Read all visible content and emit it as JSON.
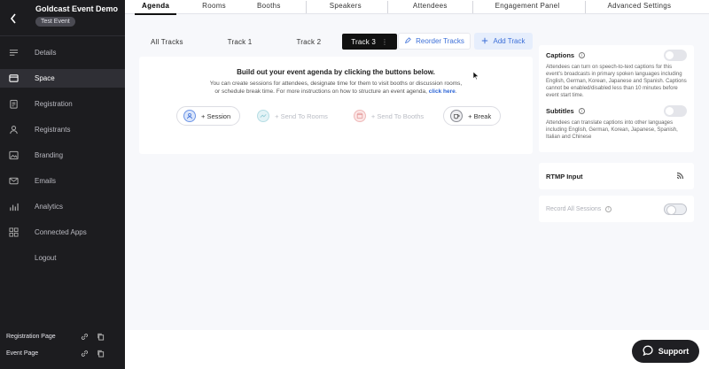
{
  "sidebar": {
    "event_title": "Goldcast Event Demo",
    "badge": "Test Event",
    "items": [
      {
        "label": "Details",
        "icon": "list-icon"
      },
      {
        "label": "Space",
        "icon": "window-icon",
        "active": true
      },
      {
        "label": "Registration",
        "icon": "clipboard-icon"
      },
      {
        "label": "Registrants",
        "icon": "person-icon"
      },
      {
        "label": "Branding",
        "icon": "image-icon"
      },
      {
        "label": "Emails",
        "icon": "mail-icon"
      },
      {
        "label": "Analytics",
        "icon": "bar-chart-icon"
      },
      {
        "label": "Connected Apps",
        "icon": "apps-icon"
      },
      {
        "label": "Logout",
        "icon": ""
      }
    ],
    "bottom_links": [
      {
        "label": "Registration Page"
      },
      {
        "label": "Event Page"
      }
    ]
  },
  "tabs": [
    {
      "label": "Agenda",
      "active": true
    },
    {
      "label": "Rooms"
    },
    {
      "label": "Booths"
    },
    {
      "label": "Speakers"
    },
    {
      "label": "Attendees"
    },
    {
      "label": "Engagement Panel"
    },
    {
      "label": "Advanced Settings"
    }
  ],
  "tracks": [
    {
      "label": "All Tracks"
    },
    {
      "label": "Track 1"
    },
    {
      "label": "Track 2"
    },
    {
      "label": "Track 3",
      "active": true,
      "menu": "⋮"
    }
  ],
  "buttons": {
    "reorder": "Reorder Tracks",
    "add_track": "Add Track"
  },
  "agenda": {
    "title": "Build out your event agenda by clicking the buttons below.",
    "desc_line1": "You can create sessions for attendees, designate time for them to visit booths or discussion rooms,",
    "desc_line2": "or schedule break time. For more instructions on how to structure an event agenda,",
    "desc_link": "click here",
    "desc_end": ".",
    "actions": [
      {
        "label": "+ Session",
        "enabled": true
      },
      {
        "label": "+ Send To Rooms",
        "enabled": false
      },
      {
        "label": "+ Send To Booths",
        "enabled": false
      },
      {
        "label": "+ Break",
        "enabled": true
      }
    ]
  },
  "captions": {
    "label": "Captions",
    "desc": "Attendees can turn on speech-to-text captions for this event's broadcasts in primary spoken languages including English, German, Korean, Japanese and Spanish. Captions cannot be enabled/disabled less than 10 minutes before event start time."
  },
  "subtitles": {
    "label": "Subtitles",
    "desc": "Attendees can translate captions into other languages including English, German, Korean, Japanese, Spanish, Italian and Chinese"
  },
  "rtmp": {
    "label": "RTMP Input"
  },
  "record": {
    "label": "Record All Sessions"
  },
  "support": {
    "label": "Support"
  },
  "colors": {
    "accent": "#3c6fd8",
    "sidebar_bg": "#1c1c1f",
    "active_track": "#111111"
  }
}
